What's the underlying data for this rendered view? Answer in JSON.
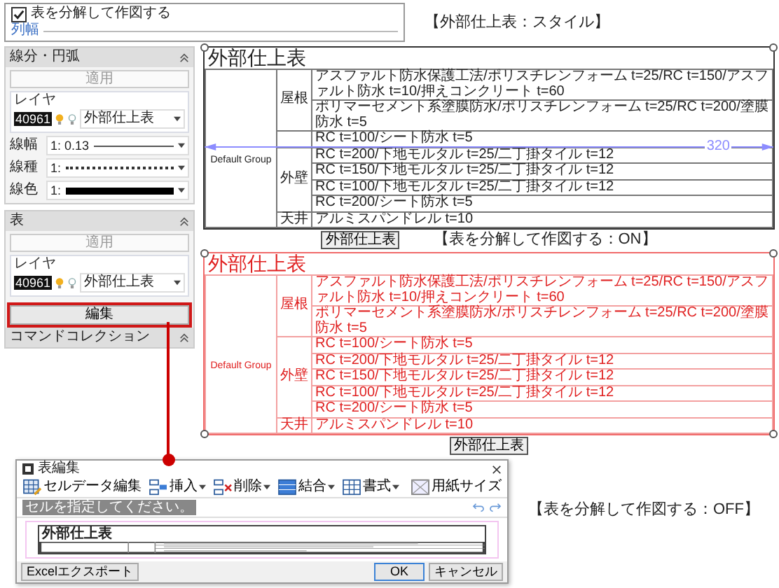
{
  "options_panel": {
    "checkbox": {
      "label": "表を分解して作図する",
      "checked": true
    },
    "section": "列幅"
  },
  "style_caption": "【外部仕上表：スタイル】",
  "line_panel": {
    "title": "線分・円弧",
    "apply": "適用",
    "layer_group": "レイヤ",
    "layer": {
      "number": "40961",
      "name": "外部仕上表"
    },
    "properties": [
      {
        "label": "線幅",
        "kind": "width",
        "value": "1: 0.13"
      },
      {
        "label": "線種",
        "kind": "type",
        "value": "1:"
      },
      {
        "label": "線色",
        "kind": "color",
        "value": "1:"
      }
    ]
  },
  "table_panel": {
    "title": "表",
    "apply": "適用",
    "layer_group": "レイヤ",
    "layer": {
      "number": "40961",
      "name": "外部仕上表"
    },
    "edit_button": {
      "label": "編集",
      "highlighted": true
    }
  },
  "command_panel": {
    "title": "コマンドコレクション"
  },
  "tables": [
    {
      "title": "外部仕上表",
      "selected": false,
      "group": "Default Group",
      "dimension": "320",
      "button": "外部仕上表",
      "caption": "【表を分解して作図する：ON】",
      "categories": [
        {
          "label": "屋根",
          "rows": [
            "アスファルト防水保護工法/ポリスチレンフォーム t=25/RC t=150/アスファルト防水 t=10/押えコンクリート t=60",
            "ポリマーセメント系塗膜防水/ポリスチレンフォーム t=25/RC t=200/塗膜防水 t=5"
          ]
        },
        {
          "rows": [
            "RC t=100/シート防水 t=5"
          ]
        },
        {
          "label": "外壁",
          "rows": [
            "RC t=200/下地モルタル t=25/二丁掛タイル t=12",
            "RC t=150/下地モルタル t=25/二丁掛タイル t=12",
            "RC t=100/下地モルタル t=25/二丁掛タイル t=12",
            "RC t=200/シート防水 t=5"
          ]
        },
        {
          "label": "天井",
          "rows": [
            "アルミスパンドレル t=10"
          ]
        }
      ]
    },
    {
      "title": "外部仕上表",
      "selected": true,
      "group": "Default Group",
      "button": "外部仕上表",
      "caption": "【表を分解して作図する：OFF】",
      "categories": [
        {
          "label": "屋根",
          "rows": [
            "アスファルト防水保護工法/ポリスチレンフォーム t=25/RC t=150/アスファルト防水 t=10/押えコンクリート t=60",
            "ポリマーセメント系塗膜防水/ポリスチレンフォーム t=25/RC t=200/塗膜防水 t=5"
          ]
        },
        {
          "label": "外壁",
          "rows": [
            "RC t=100/シート防水 t=5",
            "RC t=200/下地モルタル t=25/二丁掛タイル t=12",
            "RC t=150/下地モルタル t=25/二丁掛タイル t=12",
            "RC t=100/下地モルタル t=25/二丁掛タイル t=12",
            "RC t=200/シート防水 t=5"
          ]
        },
        {
          "label": "天井",
          "rows": [
            "アルミスパンドレル t=10"
          ]
        }
      ]
    }
  ],
  "dialog": {
    "title": "表編集",
    "tools": [
      {
        "label": "セルデータ編集",
        "kind": "edit",
        "dropdown": false
      },
      {
        "label": "挿入",
        "kind": "insert",
        "dropdown": true
      },
      {
        "label": "削除",
        "kind": "delete",
        "dropdown": true
      },
      {
        "label": "結合",
        "kind": "merge",
        "dropdown": true
      },
      {
        "label": "書式",
        "kind": "format",
        "dropdown": true
      }
    ],
    "paper_tool": "用紙サイズ",
    "message": "セルを指定してください。",
    "preview_title": "外部仕上表",
    "export_button": "Excelエクスポート",
    "ok_button": "OK",
    "cancel_button": "キャンセル"
  }
}
